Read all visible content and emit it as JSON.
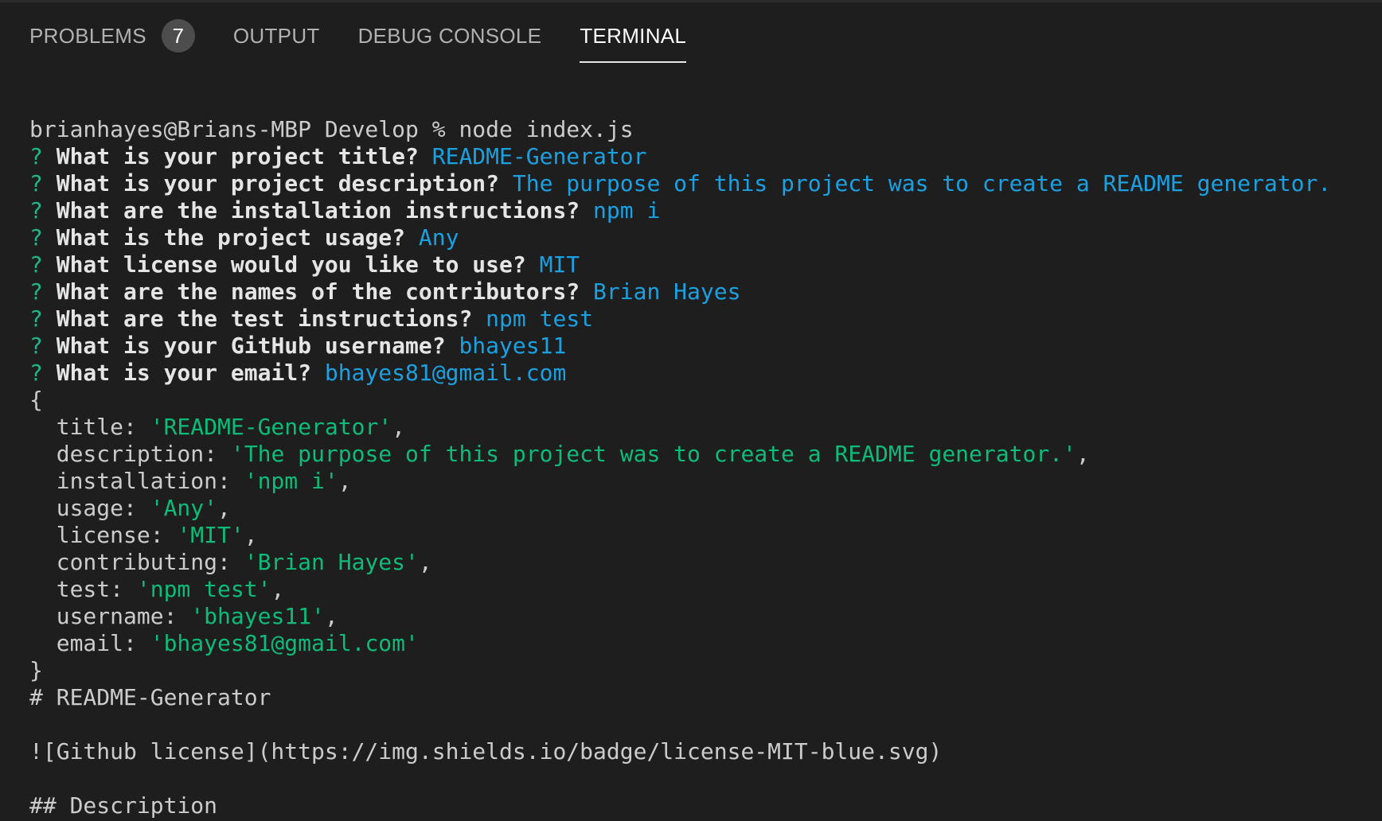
{
  "panel": {
    "tabs": [
      {
        "label": "PROBLEMS",
        "badge": "7"
      },
      {
        "label": "OUTPUT"
      },
      {
        "label": "DEBUG CONSOLE"
      },
      {
        "label": "TERMINAL"
      }
    ]
  },
  "terminal": {
    "prompt": "brianhayes@Brians-MBP Develop % node index.js",
    "qa": [
      {
        "mark": "?",
        "question": "What is your project title?",
        "answer": "README-Generator"
      },
      {
        "mark": "?",
        "question": "What is your project description?",
        "answer": "The purpose of this project was to create a README generator."
      },
      {
        "mark": "?",
        "question": "What are the installation instructions?",
        "answer": "npm i"
      },
      {
        "mark": "?",
        "question": "What is the project usage?",
        "answer": "Any"
      },
      {
        "mark": "?",
        "question": "What license would you like to use?",
        "answer": "MIT"
      },
      {
        "mark": "?",
        "question": "What are the names of the contributors?",
        "answer": "Brian Hayes"
      },
      {
        "mark": "?",
        "question": "What are the test instructions?",
        "answer": "npm test"
      },
      {
        "mark": "?",
        "question": "What is your GitHub username?",
        "answer": "bhayes11"
      },
      {
        "mark": "?",
        "question": "What is your email?",
        "answer": "bhayes81@gmail.com"
      }
    ],
    "object_open": "{",
    "object_fields": [
      {
        "key": "  title: ",
        "value": "'README-Generator'",
        "sep": ","
      },
      {
        "key": "  description: ",
        "value": "'The purpose of this project was to create a README generator.'",
        "sep": ","
      },
      {
        "key": "  installation: ",
        "value": "'npm i'",
        "sep": ","
      },
      {
        "key": "  usage: ",
        "value": "'Any'",
        "sep": ","
      },
      {
        "key": "  license: ",
        "value": "'MIT'",
        "sep": ","
      },
      {
        "key": "  contributing: ",
        "value": "'Brian Hayes'",
        "sep": ","
      },
      {
        "key": "  test: ",
        "value": "'npm test'",
        "sep": ","
      },
      {
        "key": "  username: ",
        "value": "'bhayes11'",
        "sep": ","
      },
      {
        "key": "  email: ",
        "value": "'bhayes81@gmail.com'",
        "sep": ""
      }
    ],
    "object_close": "}",
    "readme_title": "# README-Generator",
    "readme_badge": "![Github license](https://img.shields.io/badge/license-MIT-blue.svg)",
    "readme_description_heading": "## Description"
  },
  "colors": {
    "background": "#1e1e1e",
    "question_mark": "#23b58a",
    "answer": "#1ba1e2",
    "string": "#0dbc79"
  }
}
